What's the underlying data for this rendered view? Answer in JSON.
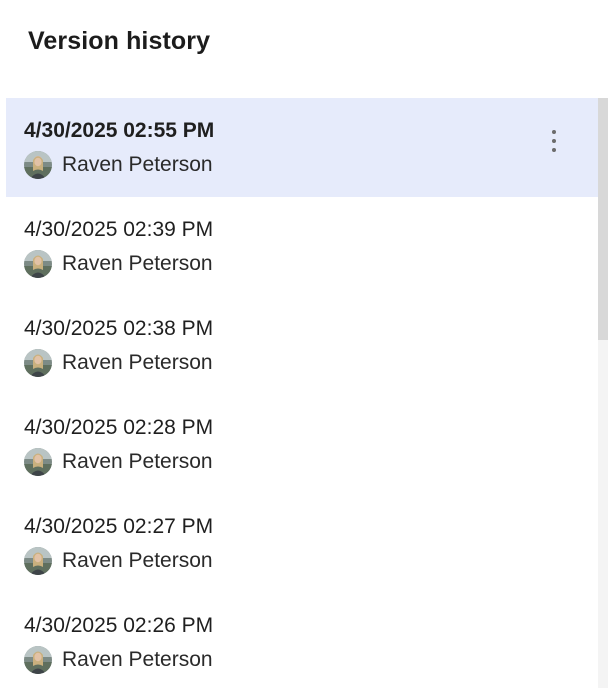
{
  "panel": {
    "title": "Version history"
  },
  "colors": {
    "selected_background": "#e6ebfb",
    "text": "#1f1f1f",
    "scrollbar_thumb": "#d8d8d8"
  },
  "versions": [
    {
      "timestamp": "4/30/2025 02:55 PM",
      "author": "Raven Peterson",
      "selected": true,
      "menu_icon": "more-vertical-icon"
    },
    {
      "timestamp": "4/30/2025 02:39 PM",
      "author": "Raven Peterson",
      "selected": false
    },
    {
      "timestamp": "4/30/2025 02:38 PM",
      "author": "Raven Peterson",
      "selected": false
    },
    {
      "timestamp": "4/30/2025 02:28 PM",
      "author": "Raven Peterson",
      "selected": false
    },
    {
      "timestamp": "4/30/2025 02:27 PM",
      "author": "Raven Peterson",
      "selected": false
    },
    {
      "timestamp": "4/30/2025 02:26 PM",
      "author": "Raven Peterson",
      "selected": false
    }
  ]
}
